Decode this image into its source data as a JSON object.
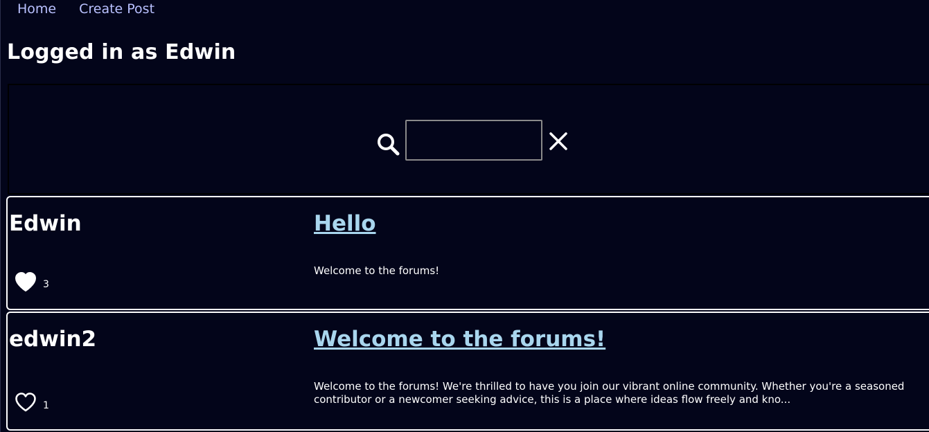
{
  "nav": {
    "home_label": "Home",
    "create_post_label": "Create Post"
  },
  "header": {
    "title": "Logged in as Edwin"
  },
  "search": {
    "value": "",
    "placeholder": ""
  },
  "posts": [
    {
      "author": "Edwin",
      "title": "Hello",
      "body": "Welcome to the forums!",
      "likes": "3",
      "liked": true
    },
    {
      "author": "edwin2",
      "title": "Welcome to the forums!",
      "body": "Welcome to the forums! We're thrilled to have you join our vibrant online community. Whether you're a seasoned contributor or a newcomer seeking advice, this is a place where ideas flow freely and kno...",
      "likes": "1",
      "liked": false
    }
  ],
  "colors": {
    "background": "#03051a",
    "nav_link": "#b9c1ff",
    "post_title": "#a9d6ee",
    "border": "#ffffff"
  },
  "icons": {
    "search": "search-icon",
    "clear": "close-icon",
    "like_filled": "heart-filled-icon",
    "like_outline": "heart-outline-icon"
  }
}
